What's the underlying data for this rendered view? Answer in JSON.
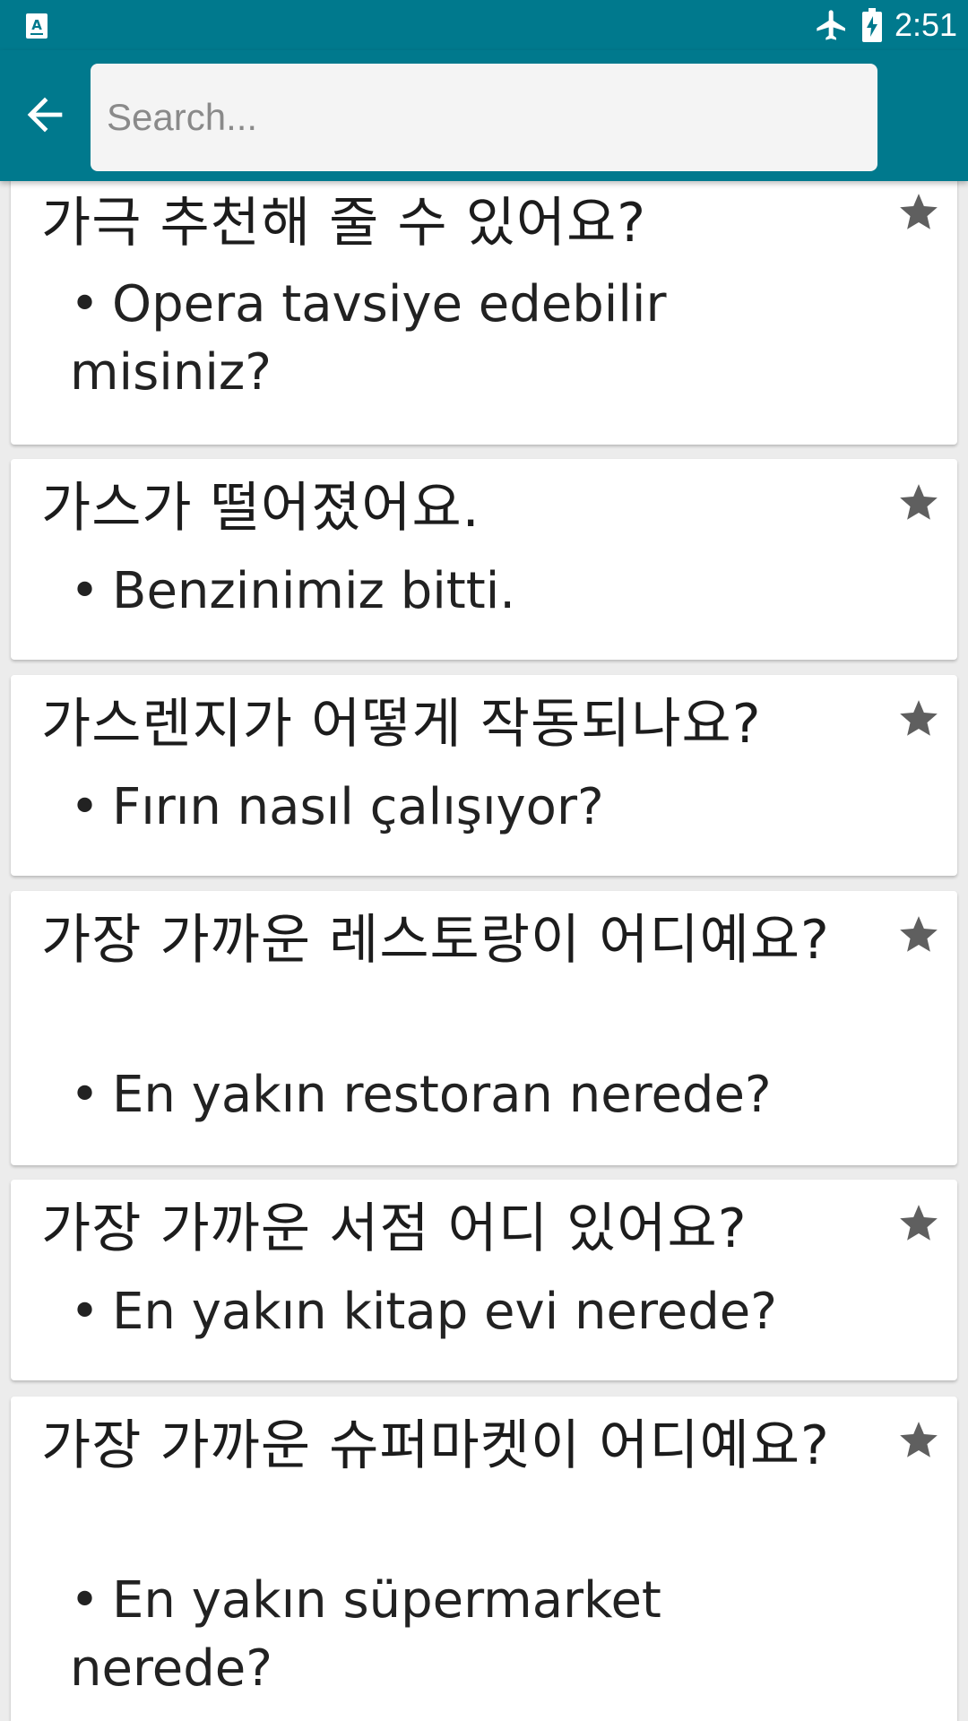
{
  "status_bar": {
    "time": "2:51",
    "icons": [
      "text-input-icon",
      "airplane-mode-icon",
      "battery-charging-icon"
    ]
  },
  "app_bar": {
    "back_icon": "arrow-back-icon",
    "search_placeholder": "Search...",
    "search_value": ""
  },
  "colors": {
    "primary": "#00798d",
    "card_background": "#ffffff",
    "list_background": "#ececec",
    "star": "#5f5f5f"
  },
  "phrases": [
    {
      "korean": "가극 추천해 줄 수 있어요?",
      "translation": "Opera tavsiye edebilir misiniz?",
      "favorite_icon": "star-icon"
    },
    {
      "korean": "가스가 떨어졌어요.",
      "translation": "Benzinimiz bitti.",
      "favorite_icon": "star-icon"
    },
    {
      "korean": "가스렌지가 어떻게 작동되나요?",
      "translation": "Fırın nasıl çalışıyor?",
      "favorite_icon": "star-icon"
    },
    {
      "korean": "가장 가까운 레스토랑이 어디예요?",
      "translation": "En yakın restoran nerede?",
      "favorite_icon": "star-icon"
    },
    {
      "korean": "가장 가까운 서점 어디 있어요?",
      "translation": "En yakın kitap evi nerede?",
      "favorite_icon": "star-icon"
    },
    {
      "korean": "가장 가까운 슈퍼마켓이 어디예요?",
      "translation": "En yakın süpermarket nerede?",
      "favorite_icon": "star-icon"
    }
  ]
}
